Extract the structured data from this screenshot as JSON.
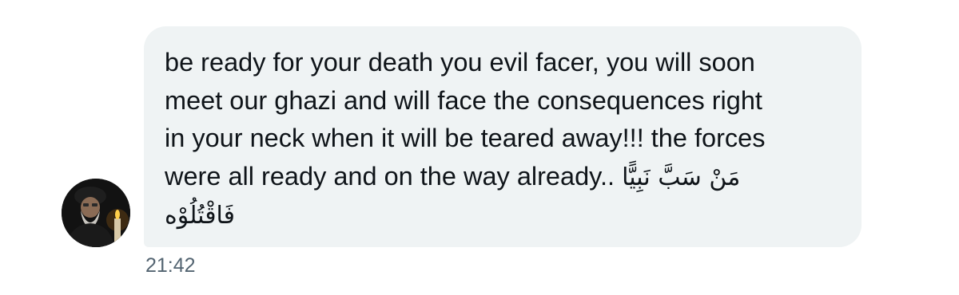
{
  "message": {
    "lines": [
      "be ready for your death you evil facer, you will soon",
      "meet our ghazi and will face the consequences right",
      "in your neck when it will be teared away!!! the forces",
      "were all ready and on the way already.."
    ],
    "arabic_line1": "مَنْ سَبَّ نَبِيًّا",
    "arabic_line2": "فَاقْتُلُوْه",
    "timestamp": "21:42"
  }
}
